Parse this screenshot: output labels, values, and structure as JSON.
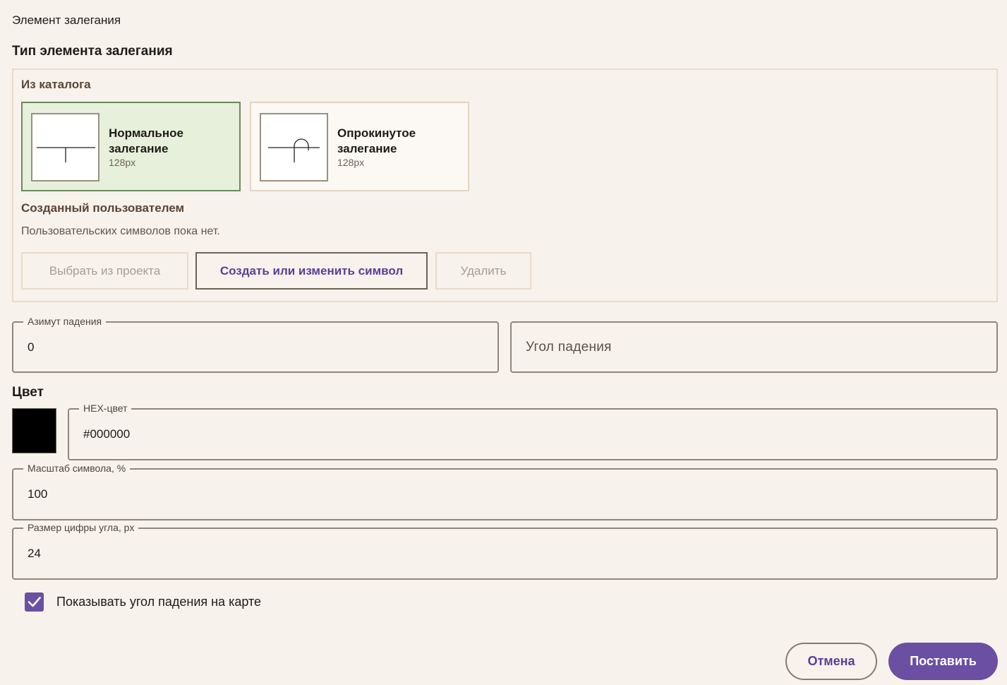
{
  "dialog": {
    "title": "Элемент залегания"
  },
  "type_section": {
    "title": "Тип элемента залегания",
    "catalog_label": "Из каталога",
    "cards": [
      {
        "name": "Нормальное залегание",
        "size": "128px",
        "selected": true
      },
      {
        "name": "Опрокинутое залегание",
        "size": "128px",
        "selected": false
      }
    ],
    "custom_label": "Созданный пользователем",
    "custom_empty": "Пользовательских символов пока нет.",
    "buttons": {
      "pick": "Выбрать из проекта",
      "create": "Создать или изменить символ",
      "delete": "Удалить"
    }
  },
  "fields": {
    "azimuth": {
      "label": "Азимут падения",
      "value": "0"
    },
    "dip": {
      "placeholder": "Угол падения"
    },
    "hex": {
      "label": "HEX-цвет",
      "value": "#000000"
    },
    "scale": {
      "label": "Масштаб символа, %",
      "value": "100"
    },
    "fontsize": {
      "label": "Размер цифры угла, px",
      "value": "24"
    }
  },
  "color": {
    "title": "Цвет",
    "swatch": "#000000"
  },
  "show_angle": {
    "label": "Показывать угол падения на карте",
    "checked": true
  },
  "actions": {
    "cancel": "Отмена",
    "place": "Поставить"
  },
  "theme": {
    "accent": "#6a4fa3",
    "selected_card_bg": "#e7f0db",
    "background": "#f7f2ec"
  }
}
